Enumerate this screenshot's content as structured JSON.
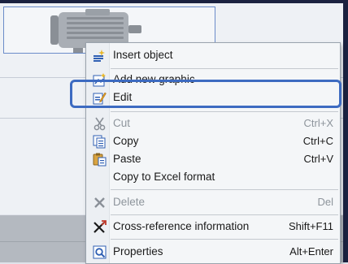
{
  "menu": {
    "items": [
      {
        "label": "Insert object",
        "shortcut": "",
        "disabled": false,
        "icon": "insert-object-icon"
      },
      {
        "label": "Add new graphic",
        "shortcut": "",
        "disabled": false,
        "icon": "add-graphic-icon"
      },
      {
        "label": "Edit",
        "shortcut": "",
        "disabled": false,
        "icon": "edit-icon"
      },
      {
        "label": "Cut",
        "shortcut": "Ctrl+X",
        "disabled": true,
        "icon": "scissors-icon"
      },
      {
        "label": "Copy",
        "shortcut": "Ctrl+C",
        "disabled": false,
        "icon": "copy-icon"
      },
      {
        "label": "Paste",
        "shortcut": "Ctrl+V",
        "disabled": false,
        "icon": "paste-icon"
      },
      {
        "label": "Copy to Excel format",
        "shortcut": "",
        "disabled": false,
        "icon": ""
      },
      {
        "label": "Delete",
        "shortcut": "Del",
        "disabled": true,
        "icon": "delete-icon"
      },
      {
        "label": "Cross-reference information",
        "shortcut": "Shift+F11",
        "disabled": false,
        "icon": "cross-reference-icon"
      },
      {
        "label": "Properties",
        "shortcut": "Alt+Enter",
        "disabled": false,
        "icon": "properties-icon"
      }
    ]
  },
  "colors": {
    "highlight_border": "#3d6bc1",
    "frame_border": "#6b8cc9",
    "disabled_text": "#8e959c"
  }
}
